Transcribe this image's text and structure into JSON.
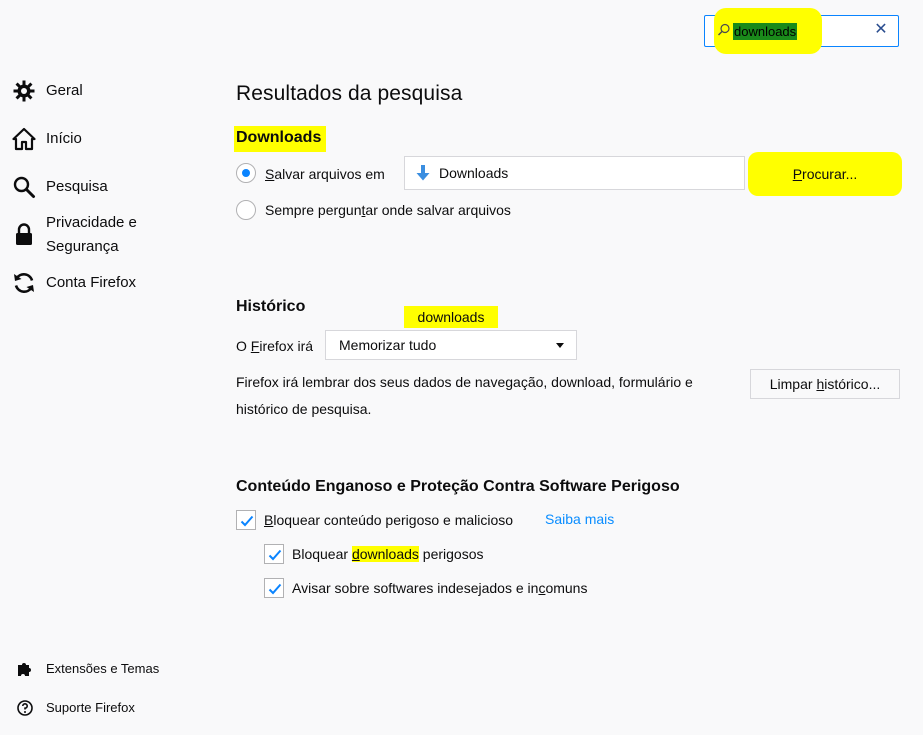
{
  "search": {
    "value": "downloads",
    "clear_glyph": "✕"
  },
  "sidebar": {
    "items": [
      {
        "label": "Geral",
        "icon": "gear-icon"
      },
      {
        "label": "Início",
        "icon": "home-icon"
      },
      {
        "label": "Pesquisa",
        "icon": "search-icon"
      },
      {
        "label": "Privacidade e",
        "label2": "Segurança",
        "icon": "lock-icon"
      },
      {
        "label": "Conta Firefox",
        "icon": "sync-icon"
      }
    ],
    "footer": [
      {
        "label": "Extensões e Temas",
        "icon": "puzzle-icon"
      },
      {
        "label": "Suporte Firefox",
        "icon": "help-icon"
      }
    ]
  },
  "main": {
    "title": "Resultados da pesquisa",
    "downloads": {
      "title": "Downloads",
      "save_to_prefix": "S",
      "save_to_rest": "alvar arquivos em",
      "folder_value": "Downloads",
      "browse_prefix": "P",
      "browse_rest": "rocurar...",
      "always_ask_a": "Sempre pergun",
      "always_ask_u": "t",
      "always_ask_b": "ar onde salvar arquivos"
    },
    "history": {
      "title": "Histórico",
      "badge": "downloads",
      "firefox_will_a": "O ",
      "firefox_will_u": "F",
      "firefox_will_b": "irefox irá",
      "mode": "Memorizar tudo",
      "desc_line1": "Firefox irá lembrar dos seus dados de navegação, download, formulário e",
      "desc_line2": "histórico de pesquisa.",
      "clear_a": "Limpar ",
      "clear_u": "h",
      "clear_b": "istórico..."
    },
    "protection": {
      "title": "Conteúdo Enganoso e Proteção Contra Software Perigoso",
      "block_u": "B",
      "block_rest": "loquear conteúdo perigoso e malicioso",
      "learn_more": "Saiba mais",
      "block_dl_a": "Bloquear ",
      "block_dl_u": "d",
      "block_dl_hl": "ownloads",
      "block_dl_b": " perigosos",
      "warn_a": "Avisar sobre softwares indesejados e in",
      "warn_u": "c",
      "warn_b": "omuns"
    }
  },
  "colors": {
    "highlight": "#ffff00",
    "accent": "#0a84ff",
    "link": "#0a8dff",
    "background": "#f9f9fa"
  }
}
